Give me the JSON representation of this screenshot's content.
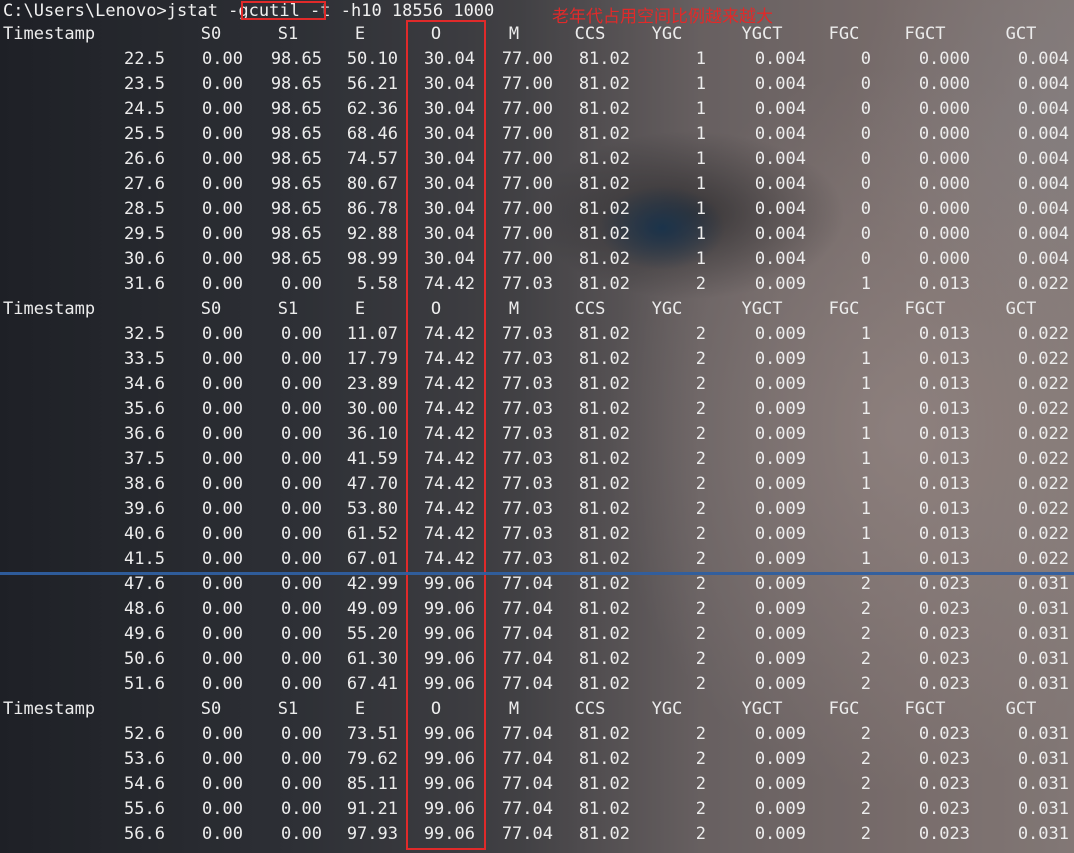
{
  "command": {
    "text": "C:\\Users\\Lenovo>jstat -gcutil -t -h10 18556 1000"
  },
  "annotation": "老年代占用空间比例越来越大",
  "headers": [
    "Timestamp",
    "S0",
    "S1",
    "E",
    "O",
    "M",
    "CCS",
    "YGC",
    "YGCT",
    "FGC",
    "FGCT",
    "GCT"
  ],
  "blocks": [
    [
      [
        "22.5",
        "0.00",
        "98.65",
        "50.10",
        "30.04",
        "77.00",
        "81.02",
        "1",
        "0.004",
        "0",
        "0.000",
        "0.004"
      ],
      [
        "23.5",
        "0.00",
        "98.65",
        "56.21",
        "30.04",
        "77.00",
        "81.02",
        "1",
        "0.004",
        "0",
        "0.000",
        "0.004"
      ],
      [
        "24.5",
        "0.00",
        "98.65",
        "62.36",
        "30.04",
        "77.00",
        "81.02",
        "1",
        "0.004",
        "0",
        "0.000",
        "0.004"
      ],
      [
        "25.5",
        "0.00",
        "98.65",
        "68.46",
        "30.04",
        "77.00",
        "81.02",
        "1",
        "0.004",
        "0",
        "0.000",
        "0.004"
      ],
      [
        "26.6",
        "0.00",
        "98.65",
        "74.57",
        "30.04",
        "77.00",
        "81.02",
        "1",
        "0.004",
        "0",
        "0.000",
        "0.004"
      ],
      [
        "27.6",
        "0.00",
        "98.65",
        "80.67",
        "30.04",
        "77.00",
        "81.02",
        "1",
        "0.004",
        "0",
        "0.000",
        "0.004"
      ],
      [
        "28.5",
        "0.00",
        "98.65",
        "86.78",
        "30.04",
        "77.00",
        "81.02",
        "1",
        "0.004",
        "0",
        "0.000",
        "0.004"
      ],
      [
        "29.5",
        "0.00",
        "98.65",
        "92.88",
        "30.04",
        "77.00",
        "81.02",
        "1",
        "0.004",
        "0",
        "0.000",
        "0.004"
      ],
      [
        "30.6",
        "0.00",
        "98.65",
        "98.99",
        "30.04",
        "77.00",
        "81.02",
        "1",
        "0.004",
        "0",
        "0.000",
        "0.004"
      ],
      [
        "31.6",
        "0.00",
        "0.00",
        "5.58",
        "74.42",
        "77.03",
        "81.02",
        "2",
        "0.009",
        "1",
        "0.013",
        "0.022"
      ]
    ],
    [
      [
        "32.5",
        "0.00",
        "0.00",
        "11.07",
        "74.42",
        "77.03",
        "81.02",
        "2",
        "0.009",
        "1",
        "0.013",
        "0.022"
      ],
      [
        "33.5",
        "0.00",
        "0.00",
        "17.79",
        "74.42",
        "77.03",
        "81.02",
        "2",
        "0.009",
        "1",
        "0.013",
        "0.022"
      ],
      [
        "34.6",
        "0.00",
        "0.00",
        "23.89",
        "74.42",
        "77.03",
        "81.02",
        "2",
        "0.009",
        "1",
        "0.013",
        "0.022"
      ],
      [
        "35.6",
        "0.00",
        "0.00",
        "30.00",
        "74.42",
        "77.03",
        "81.02",
        "2",
        "0.009",
        "1",
        "0.013",
        "0.022"
      ],
      [
        "36.6",
        "0.00",
        "0.00",
        "36.10",
        "74.42",
        "77.03",
        "81.02",
        "2",
        "0.009",
        "1",
        "0.013",
        "0.022"
      ],
      [
        "37.5",
        "0.00",
        "0.00",
        "41.59",
        "74.42",
        "77.03",
        "81.02",
        "2",
        "0.009",
        "1",
        "0.013",
        "0.022"
      ],
      [
        "38.6",
        "0.00",
        "0.00",
        "47.70",
        "74.42",
        "77.03",
        "81.02",
        "2",
        "0.009",
        "1",
        "0.013",
        "0.022"
      ],
      [
        "39.6",
        "0.00",
        "0.00",
        "53.80",
        "74.42",
        "77.03",
        "81.02",
        "2",
        "0.009",
        "1",
        "0.013",
        "0.022"
      ],
      [
        "40.6",
        "0.00",
        "0.00",
        "61.52",
        "74.42",
        "77.03",
        "81.02",
        "2",
        "0.009",
        "1",
        "0.013",
        "0.022"
      ],
      [
        "41.5",
        "0.00",
        "0.00",
        "67.01",
        "74.42",
        "77.03",
        "81.02",
        "2",
        "0.009",
        "1",
        "0.013",
        "0.022"
      ],
      [
        "47.6",
        "0.00",
        "0.00",
        "42.99",
        "99.06",
        "77.04",
        "81.02",
        "2",
        "0.009",
        "2",
        "0.023",
        "0.031"
      ],
      [
        "48.6",
        "0.00",
        "0.00",
        "49.09",
        "99.06",
        "77.04",
        "81.02",
        "2",
        "0.009",
        "2",
        "0.023",
        "0.031"
      ],
      [
        "49.6",
        "0.00",
        "0.00",
        "55.20",
        "99.06",
        "77.04",
        "81.02",
        "2",
        "0.009",
        "2",
        "0.023",
        "0.031"
      ],
      [
        "50.6",
        "0.00",
        "0.00",
        "61.30",
        "99.06",
        "77.04",
        "81.02",
        "2",
        "0.009",
        "2",
        "0.023",
        "0.031"
      ],
      [
        "51.6",
        "0.00",
        "0.00",
        "67.41",
        "99.06",
        "77.04",
        "81.02",
        "2",
        "0.009",
        "2",
        "0.023",
        "0.031"
      ]
    ],
    [
      [
        "52.6",
        "0.00",
        "0.00",
        "73.51",
        "99.06",
        "77.04",
        "81.02",
        "2",
        "0.009",
        "2",
        "0.023",
        "0.031"
      ],
      [
        "53.6",
        "0.00",
        "0.00",
        "79.62",
        "99.06",
        "77.04",
        "81.02",
        "2",
        "0.009",
        "2",
        "0.023",
        "0.031"
      ],
      [
        "54.6",
        "0.00",
        "0.00",
        "85.11",
        "99.06",
        "77.04",
        "81.02",
        "2",
        "0.009",
        "2",
        "0.023",
        "0.031"
      ],
      [
        "55.6",
        "0.00",
        "0.00",
        "91.21",
        "99.06",
        "77.04",
        "81.02",
        "2",
        "0.009",
        "2",
        "0.023",
        "0.031"
      ],
      [
        "56.6",
        "0.00",
        "0.00",
        "97.93",
        "99.06",
        "77.04",
        "81.02",
        "2",
        "0.009",
        "2",
        "0.023",
        "0.031"
      ]
    ]
  ],
  "colors": {
    "highlight": "#e02a2a",
    "separator": "#2f5fa0"
  }
}
